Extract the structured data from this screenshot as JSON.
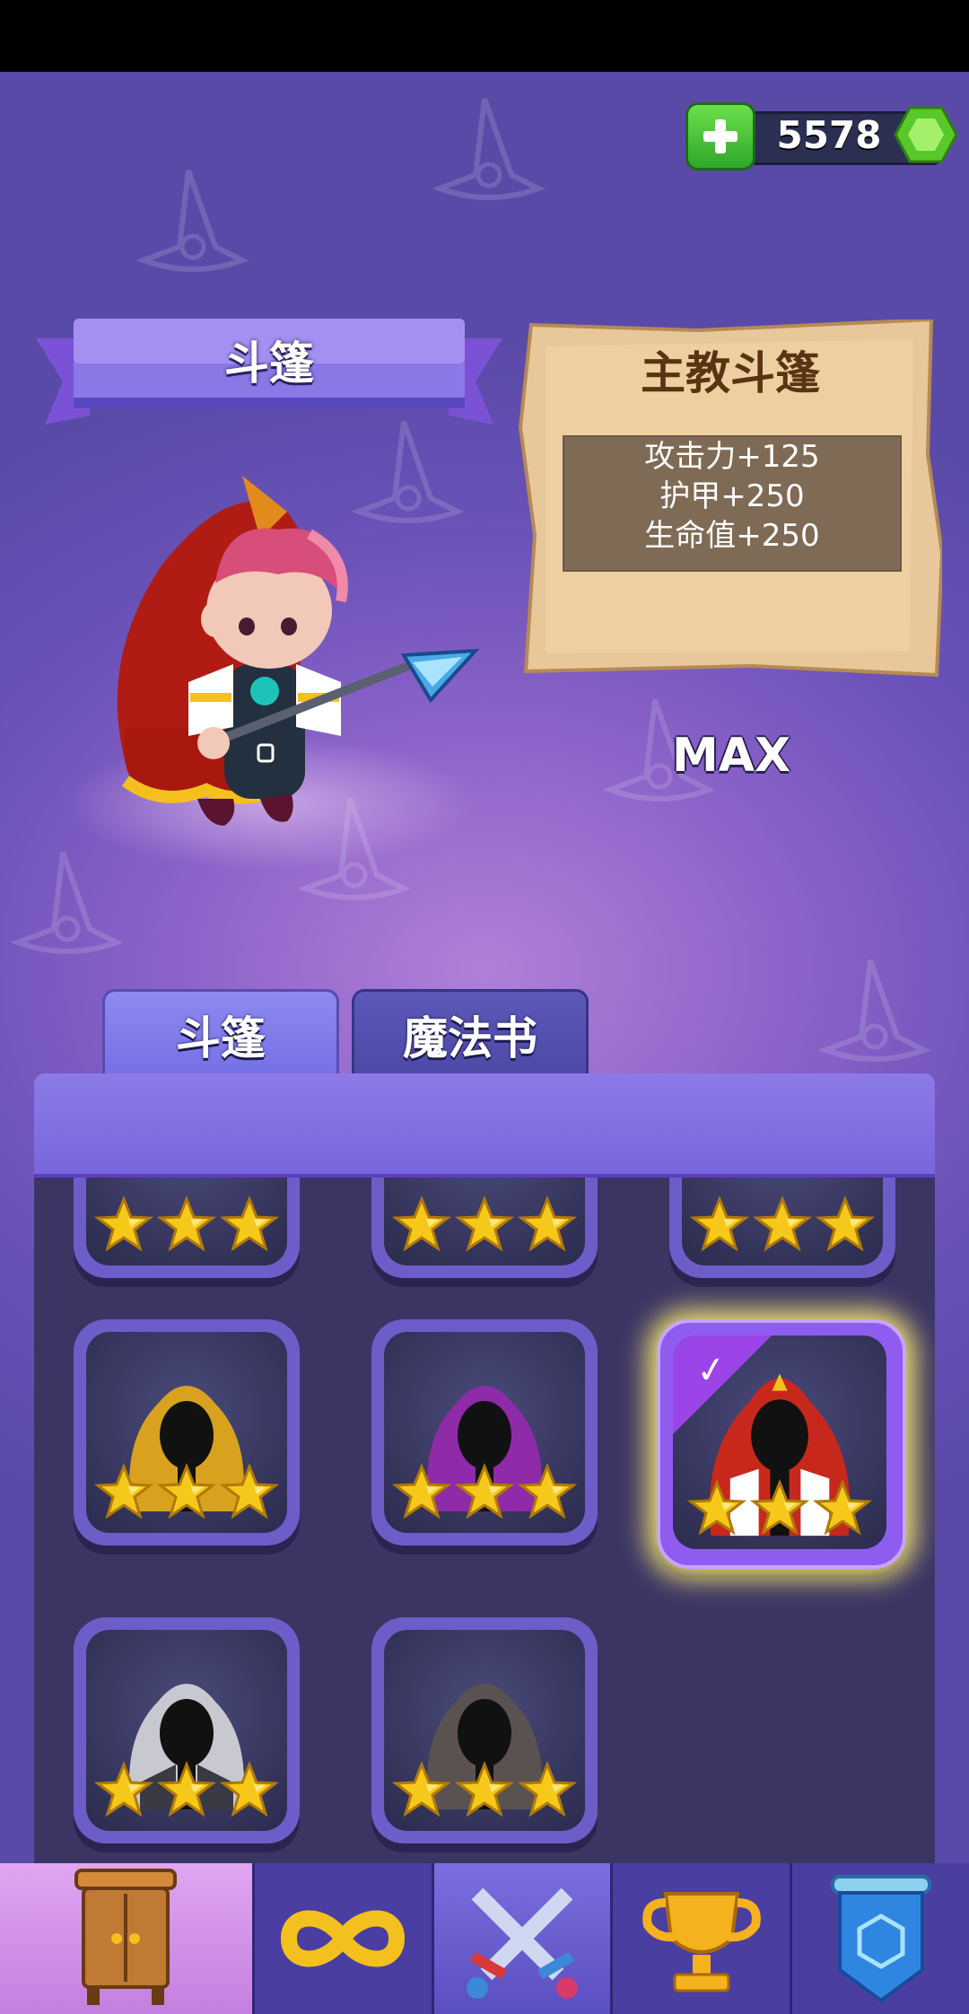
{
  "currency": {
    "value": "5578",
    "plus_icon": "plus-icon",
    "gem_icon": "green-gem-icon"
  },
  "title_ribbon": {
    "label": "斗篷"
  },
  "item_info": {
    "name": "主教斗篷",
    "stats": [
      "攻击力+125",
      "护甲+250",
      "生命值+250"
    ],
    "level_status": "MAX"
  },
  "tabs": [
    {
      "label": "斗篷",
      "active": true
    },
    {
      "label": "魔法书",
      "active": false
    }
  ],
  "cloak_grid": {
    "rows": [
      [
        {
          "name": "red-cloak-card",
          "stars": 3
        },
        {
          "name": "ice-cloak-card",
          "stars": 3
        },
        {
          "name": "green-cloak-card",
          "stars": 3
        }
      ],
      [
        {
          "name": "yellow-hood-card",
          "stars": 3,
          "color": "#d8a21e"
        },
        {
          "name": "purple-hood-card",
          "stars": 3,
          "color": "#8f2aa8"
        },
        {
          "name": "bishop-cloak-card",
          "stars": 3,
          "color": "#c8281c",
          "selected": true
        }
      ],
      [
        {
          "name": "white-hood-card",
          "stars": 3,
          "color": "#c8c8d0"
        },
        {
          "name": "gray-hood-card",
          "stars": 3,
          "color": "#5a5250"
        }
      ]
    ]
  },
  "bottom_nav": [
    {
      "name": "wardrobe",
      "icon": "wardrobe-icon",
      "active": true
    },
    {
      "name": "endless",
      "icon": "infinity-icon",
      "active": false
    },
    {
      "name": "battle",
      "icon": "crossed-swords-icon",
      "active": false
    },
    {
      "name": "trophy",
      "icon": "trophy-icon",
      "active": false
    },
    {
      "name": "guild",
      "icon": "shield-banner-icon",
      "active": false
    }
  ],
  "colors": {
    "accent": "#7a66dc",
    "panel": "#3b3564",
    "star": "#f6c81a",
    "gem": "#6fd83a"
  }
}
